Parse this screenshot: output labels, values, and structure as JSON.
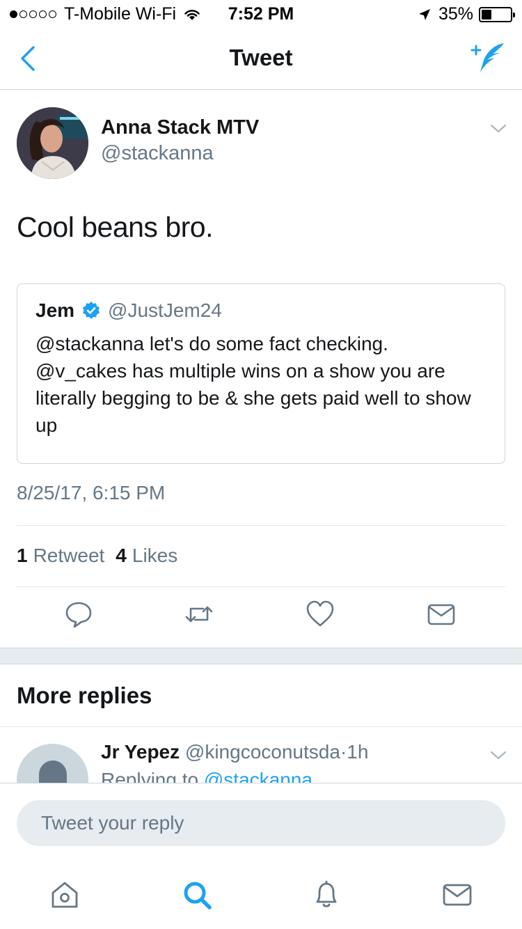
{
  "status_bar": {
    "carrier": "T-Mobile Wi-Fi",
    "time": "7:52 PM",
    "battery_percent": "35%",
    "battery_level": 0.35
  },
  "nav": {
    "title": "Tweet",
    "back_icon": "chevron-left-icon",
    "compose_icon": "compose-tweet-icon"
  },
  "tweet": {
    "author_name": "Anna Stack MTV",
    "author_handle": "@stackanna",
    "text": "Cool beans bro.",
    "quote": {
      "name": "Jem",
      "handle": "@JustJem24",
      "text": "@stackanna let's do some fact checking. @v_cakes has multiple wins on a show you are literally begging to be & she gets paid well to show up"
    },
    "timestamp": "8/25/17, 6:15 PM",
    "stats": {
      "retweets_count": "1",
      "retweets_label": "Retweet",
      "likes_count": "4",
      "likes_label": "Likes"
    }
  },
  "more_replies": {
    "heading": "More replies",
    "reply": {
      "name": "Jr Yepez",
      "handle": "@kingcoconutsda",
      "separator": "·",
      "time": "1h",
      "replying_prefix": "Replying to ",
      "replying_to": "@stackanna"
    }
  },
  "reply_bar": {
    "placeholder": "Tweet your reply"
  },
  "colors": {
    "accent": "#1da1f2",
    "text": "#14171a",
    "secondary": "#657786",
    "border": "#ccd6dd"
  }
}
